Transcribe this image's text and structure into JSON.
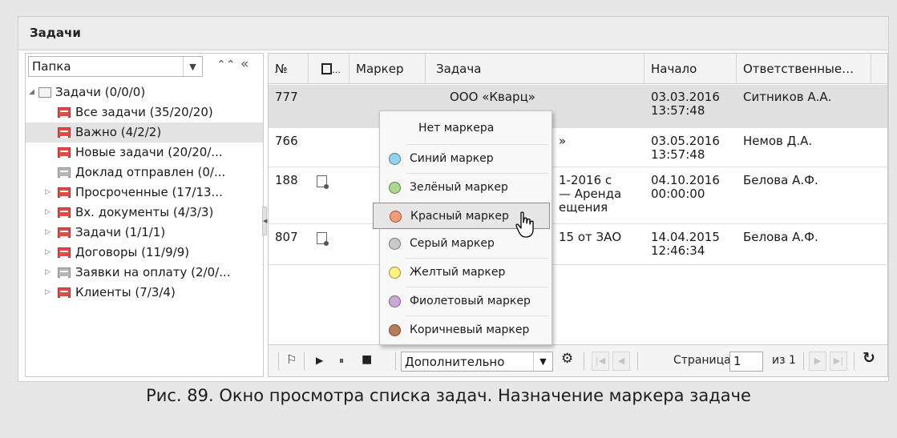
{
  "window": {
    "title": "Задачи"
  },
  "left_panel": {
    "folder_select": {
      "value": "Папка",
      "dropdown_icon": "chevron-down-icon"
    },
    "collapse_icon": "⌃⌃",
    "hide_icon": "«",
    "tree": [
      {
        "label": "Задачи (0/0/0)",
        "icon": "folder-icon",
        "expander": "◢"
      },
      {
        "label": "Все задачи (35/20/20)",
        "icon": "red-filter-icon"
      },
      {
        "label": "Важно (4/2/2)",
        "icon": "red-filter-icon",
        "selected": true
      },
      {
        "label": "Новые задачи (20/20/...",
        "icon": "red-filter-icon"
      },
      {
        "label": "Доклад отправлен (0/...",
        "icon": "gray-filter-icon"
      },
      {
        "label": "Просроченные (17/13...",
        "icon": "red-filter-icon",
        "expander": "▷"
      },
      {
        "label": "Вх. документы (4/3/3)",
        "icon": "red-filter-icon",
        "expander": "▷"
      },
      {
        "label": "Задачи (1/1/1)",
        "icon": "red-filter-icon",
        "expander": "▷"
      },
      {
        "label": "Договоры (11/9/9)",
        "icon": "red-filter-icon",
        "expander": "▷"
      },
      {
        "label": "Заявки на оплату (2/0/...",
        "icon": "gray-filter-icon",
        "expander": "▷"
      },
      {
        "label": "Клиенты (7/3/4)",
        "icon": "red-filter-icon",
        "expander": "▷"
      }
    ]
  },
  "grid": {
    "columns": [
      "№",
      "…",
      "Маркер",
      "Задача",
      "Начало",
      "Ответственные…"
    ],
    "rows": [
      {
        "num": "777",
        "task": "ООО «Кварц»",
        "start_date": "03.03.2016",
        "start_time": "13:57:48",
        "responsible": "Ситников А.А."
      },
      {
        "num": "766",
        "task": "»",
        "start_date": "03.05.2016",
        "start_time": "13:57:48",
        "responsible": "Немов Д.А."
      },
      {
        "num": "188",
        "task_l1": "1-2016 с",
        "task_l2": "— Аренда",
        "task_l3": "ещения",
        "start_date": "04.10.2016",
        "start_time": "00:00:00",
        "responsible": "Белова А.Ф."
      },
      {
        "num": "807",
        "task": "15 от ЗАО",
        "start_date": "14.04.2015",
        "start_time": "12:46:34",
        "responsible": "Белова А.Ф."
      }
    ]
  },
  "toolbar": {
    "flag_icon": "⚐",
    "play_icon": "▶",
    "pause_icon": "⏸",
    "stop_icon": "■",
    "extra_select": "Дополнительно",
    "page_label": "Страница",
    "page_value": "1",
    "of_label": "из 1",
    "refresh_icon": "↻"
  },
  "marker_menu": {
    "items": [
      {
        "label": "Нет маркера",
        "color": null
      },
      {
        "label": "Синий маркер",
        "color": "#8fd3ee"
      },
      {
        "label": "Зелёный маркер",
        "color": "#a8d98a"
      },
      {
        "label": "Красный маркер",
        "color": "#f59a76",
        "highlighted": true
      },
      {
        "label": "Серый маркер",
        "color": "#c9c9c9"
      },
      {
        "label": "Желтый маркер",
        "color": "#fff27a"
      },
      {
        "label": "Фиолетовый маркер",
        "color": "#c8a9d8"
      },
      {
        "label": "Коричневый маркер",
        "color": "#b97d55"
      }
    ]
  },
  "caption": "Рис. 89. Окно просмотра списка задач. Назначение маркера задаче"
}
